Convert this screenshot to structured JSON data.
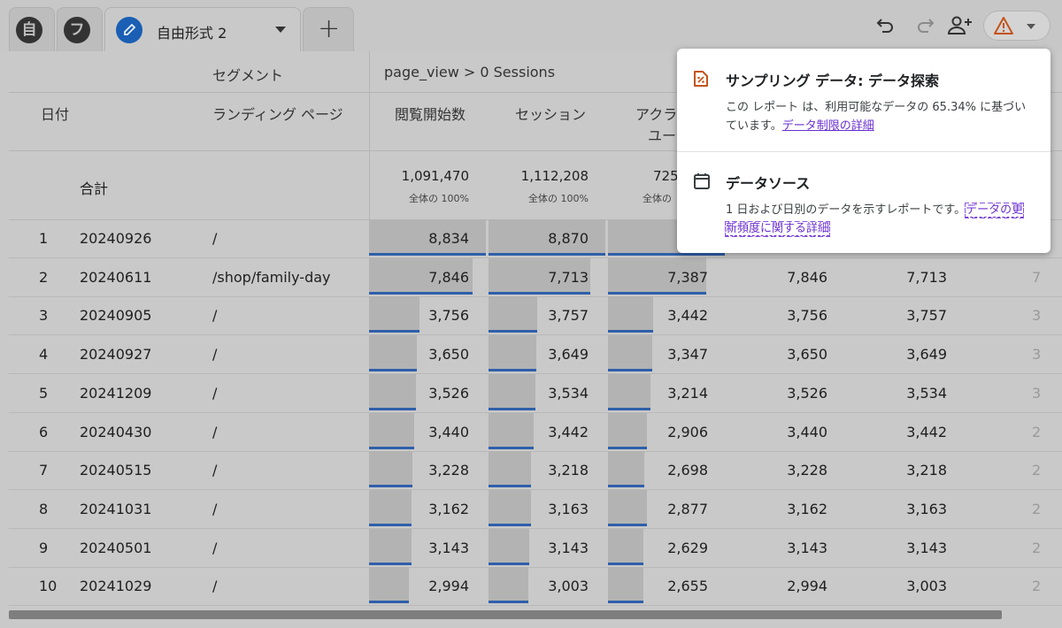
{
  "tabs": [
    {
      "glyph": "自"
    },
    {
      "glyph": "フ"
    },
    {
      "label": "自由形式 2"
    }
  ],
  "table": {
    "header_segment": "セグメント",
    "header_segment_value": "page_view > 0 Sessions",
    "col_date": "日付",
    "col_page": "ランディング ページ",
    "col_views": "閲覧開始数",
    "col_sessions": "セッション",
    "col_active": "アクラ",
    "col_active_line2": "ユー",
    "total_label": "合計",
    "total_views": "1,091,470",
    "total_views_sub": "全体の 100%",
    "total_sessions": "1,112,208",
    "total_sessions_sub": "全体の 100%",
    "total_active": "725",
    "total_active_sub": "全体の",
    "rows": [
      {
        "idx": "1",
        "date": "20240926",
        "page": "/",
        "v": "8,834",
        "s": "8,870",
        "a": "",
        "v2": "",
        "s2": "",
        "c8": "",
        "bars": [
          1.0,
          1.0,
          1.0
        ]
      },
      {
        "idx": "2",
        "date": "20240611",
        "page": "/shop/family-day",
        "v": "7,846",
        "s": "7,713",
        "a": "7,387",
        "v2": "7,846",
        "s2": "7,713",
        "c8": "7",
        "bars": [
          0.89,
          0.87,
          0.84
        ]
      },
      {
        "idx": "3",
        "date": "20240905",
        "page": "/",
        "v": "3,756",
        "s": "3,757",
        "a": "3,442",
        "v2": "3,756",
        "s2": "3,757",
        "c8": "3",
        "bars": [
          0.43,
          0.42,
          0.39
        ]
      },
      {
        "idx": "4",
        "date": "20240927",
        "page": "/",
        "v": "3,650",
        "s": "3,649",
        "a": "3,347",
        "v2": "3,650",
        "s2": "3,649",
        "c8": "3",
        "bars": [
          0.41,
          0.41,
          0.38
        ]
      },
      {
        "idx": "5",
        "date": "20241209",
        "page": "/",
        "v": "3,526",
        "s": "3,534",
        "a": "3,214",
        "v2": "3,526",
        "s2": "3,534",
        "c8": "3",
        "bars": [
          0.4,
          0.4,
          0.36
        ]
      },
      {
        "idx": "6",
        "date": "20240430",
        "page": "/",
        "v": "3,440",
        "s": "3,442",
        "a": "2,906",
        "v2": "3,440",
        "s2": "3,442",
        "c8": "2",
        "bars": [
          0.39,
          0.39,
          0.33
        ]
      },
      {
        "idx": "7",
        "date": "20240515",
        "page": "/",
        "v": "3,228",
        "s": "3,218",
        "a": "2,698",
        "v2": "3,228",
        "s2": "3,218",
        "c8": "2",
        "bars": [
          0.37,
          0.36,
          0.31
        ]
      },
      {
        "idx": "8",
        "date": "20241031",
        "page": "/",
        "v": "3,162",
        "s": "3,163",
        "a": "2,877",
        "v2": "3,162",
        "s2": "3,163",
        "c8": "2",
        "bars": [
          0.36,
          0.36,
          0.33
        ]
      },
      {
        "idx": "9",
        "date": "20240501",
        "page": "/",
        "v": "3,143",
        "s": "3,143",
        "a": "2,629",
        "v2": "3,143",
        "s2": "3,143",
        "c8": "2",
        "bars": [
          0.36,
          0.35,
          0.3
        ]
      },
      {
        "idx": "10",
        "date": "20241029",
        "page": "/",
        "v": "2,994",
        "s": "3,003",
        "a": "2,655",
        "v2": "2,994",
        "s2": "3,003",
        "c8": "2",
        "bars": [
          0.34,
          0.34,
          0.3
        ]
      }
    ]
  },
  "popup": {
    "sampling_title": "サンプリング データ: データ探索",
    "sampling_body": "この レポート は、利用可能なデータの 65.34% に基づいています。",
    "sampling_link": "データ制限の詳細",
    "source_title": "データソース",
    "source_body": "1 日および日別のデータを示すレポートです。",
    "source_link": "データの更新頻度に関する詳細"
  },
  "colors": {
    "bar_line": "#2f5faa",
    "warning": "#c5531a",
    "link": "#6a2fd1",
    "tab_active_icon": "#1a73e8"
  },
  "icons": [
    "undo-icon",
    "redo-icon",
    "share-user-icon",
    "warning-icon",
    "sampling-icon",
    "calendar-icon"
  ]
}
